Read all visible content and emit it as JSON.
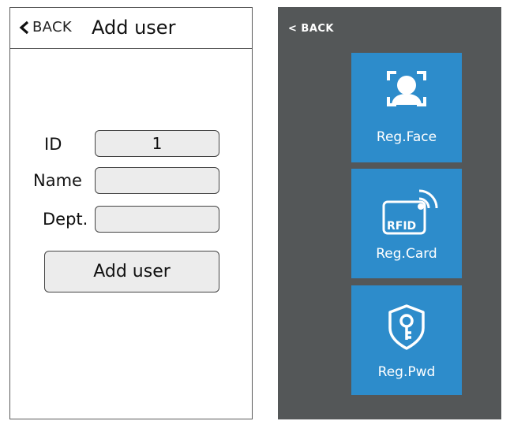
{
  "left_screen": {
    "back_label": "BACK",
    "title": "Add user",
    "form": {
      "id_label": "ID",
      "id_value": "1",
      "name_label": "Name",
      "name_value": "",
      "dept_label": "Dept.",
      "dept_value": ""
    },
    "submit_label": "Add user",
    "icons": {
      "back": "chevron-left-icon"
    }
  },
  "right_screen": {
    "back_label": "< BACK",
    "tiles": [
      {
        "label": "Reg.Face",
        "icon": "face-scan-icon"
      },
      {
        "label": "Reg.Card",
        "icon": "rfid-card-icon",
        "icon_text": "RFID"
      },
      {
        "label": "Reg.Pwd",
        "icon": "shield-key-icon"
      }
    ]
  },
  "colors": {
    "tile_blue": "#2d8ccb",
    "right_background": "#545758",
    "field_fill": "#ececec"
  }
}
